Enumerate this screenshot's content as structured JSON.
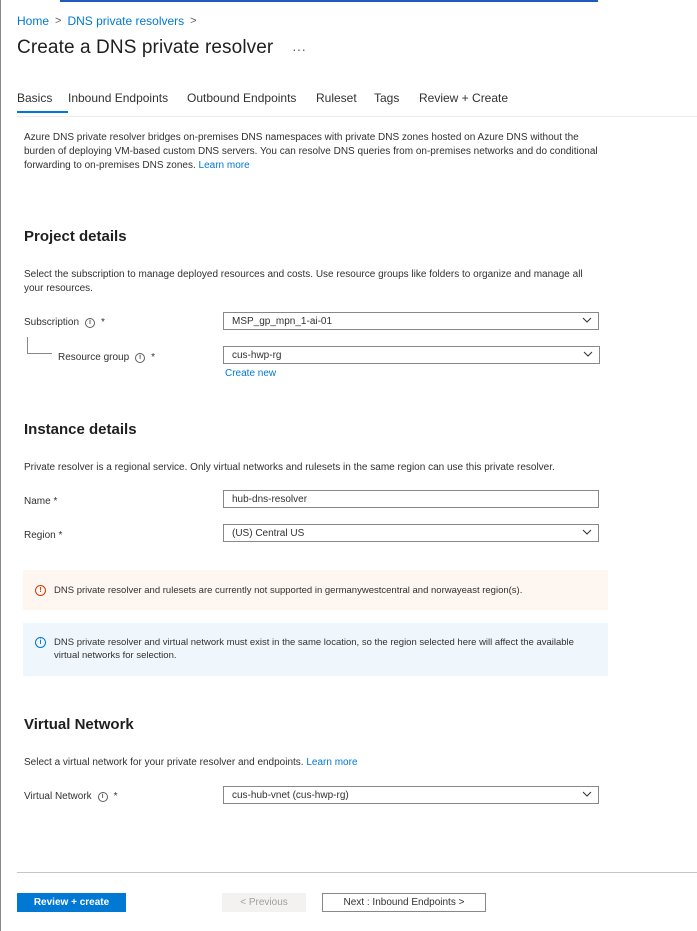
{
  "breadcrumb": {
    "home": "Home",
    "parent": "DNS private resolvers",
    "sep": ">"
  },
  "title": "Create a DNS private resolver",
  "more": "···",
  "tabs": [
    {
      "label": "Basics",
      "active": true
    },
    {
      "label": "Inbound Endpoints"
    },
    {
      "label": "Outbound Endpoints"
    },
    {
      "label": "Ruleset"
    },
    {
      "label": "Tags"
    },
    {
      "label": "Review + Create"
    }
  ],
  "intro": {
    "text": "Azure DNS private resolver bridges on-premises DNS namespaces with private DNS zones hosted on Azure DNS without the burden of deploying VM-based custom DNS servers. You can resolve DNS queries from on-premises networks and do conditional forwarding to on-premises DNS zones.",
    "link": "Learn more"
  },
  "project": {
    "title": "Project details",
    "desc": "Select the subscription to manage deployed resources and costs. Use resource groups like folders to organize and manage all your resources.",
    "subscription_label": "Subscription",
    "subscription_value": "MSP_gp_mpn_1-ai-01",
    "rg_label": "Resource group",
    "rg_value": "cus-hwp-rg",
    "create_new": "Create new"
  },
  "instance": {
    "title": "Instance details",
    "desc": "Private resolver is a regional service. Only virtual networks and rulesets in the same region can use this private resolver.",
    "name_label": "Name *",
    "name_value": "hub-dns-resolver",
    "region_label": "Region *",
    "region_value": "(US) Central US"
  },
  "warning": "DNS private resolver and rulesets are currently not supported in germanywestcentral and norwayeast region(s).",
  "info": "DNS private resolver and virtual network must exist in the same location, so the region selected here will affect the available virtual networks for selection.",
  "vnet": {
    "title": "Virtual Network",
    "desc": "Select a virtual network for your private resolver and endpoints.",
    "link": "Learn more",
    "label": "Virtual Network",
    "value": "cus-hub-vnet (cus-hwp-rg)"
  },
  "footer": {
    "review": "Review + create",
    "previous": "< Previous",
    "next": "Next : Inbound Endpoints >"
  },
  "common": {
    "required": "*",
    "info_glyph": "i",
    "warn_glyph": "!"
  },
  "colors": {
    "accent": "#0078d4",
    "warning_bg": "#fdf6f1",
    "info_bg": "#eff6fc"
  }
}
